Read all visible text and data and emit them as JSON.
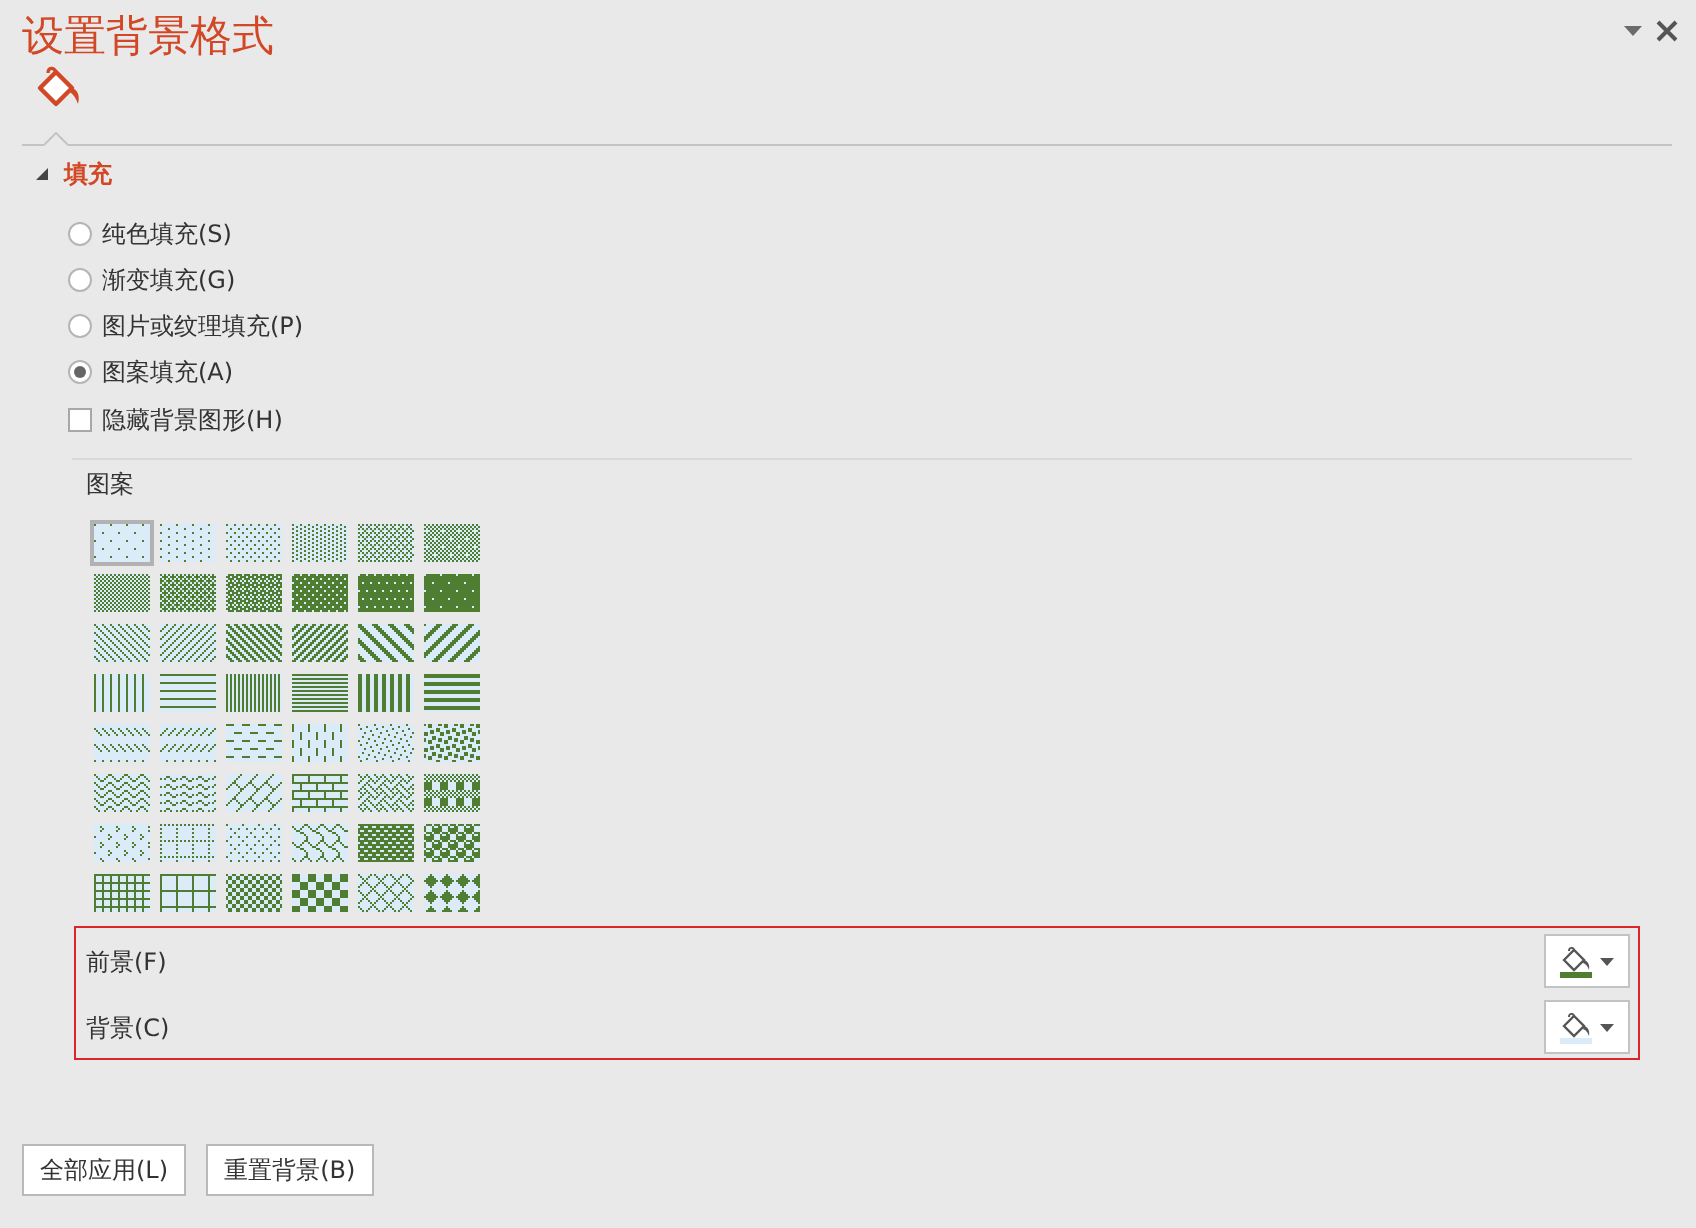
{
  "panel": {
    "title": "设置背景格式"
  },
  "section": {
    "label": "填充",
    "expanded": true
  },
  "fill_options": [
    {
      "label": "纯色填充(S)",
      "selected": false
    },
    {
      "label": "渐变填充(G)",
      "selected": false
    },
    {
      "label": "图片或纹理填充(P)",
      "selected": false
    },
    {
      "label": "图案填充(A)",
      "selected": true
    }
  ],
  "hide_graphics": {
    "label": "隐藏背景图形(H)",
    "checked": false
  },
  "pattern_group": {
    "label": "图案",
    "patterns": [
      {
        "kind": "pct5",
        "selected": true
      },
      {
        "kind": "pct10",
        "selected": false
      },
      {
        "kind": "pct20",
        "selected": false
      },
      {
        "kind": "pct25",
        "selected": false
      },
      {
        "kind": "pct30",
        "selected": false
      },
      {
        "kind": "pct40",
        "selected": false
      },
      {
        "kind": "pct50",
        "selected": false
      },
      {
        "kind": "pct60",
        "selected": false
      },
      {
        "kind": "pct70",
        "selected": false
      },
      {
        "kind": "pct75",
        "selected": false
      },
      {
        "kind": "pct80",
        "selected": false
      },
      {
        "kind": "pct90",
        "selected": false
      },
      {
        "kind": "lightdowndiag",
        "selected": false
      },
      {
        "kind": "lightupdiag",
        "selected": false
      },
      {
        "kind": "darkdowndiag",
        "selected": false
      },
      {
        "kind": "darkupdiag",
        "selected": false
      },
      {
        "kind": "widedowndiag",
        "selected": false
      },
      {
        "kind": "wideupdiag",
        "selected": false
      },
      {
        "kind": "lightvertical",
        "selected": false
      },
      {
        "kind": "lighthorizontal",
        "selected": false
      },
      {
        "kind": "narrowvertical",
        "selected": false
      },
      {
        "kind": "narrowhorizontal",
        "selected": false
      },
      {
        "kind": "darkvertical",
        "selected": false
      },
      {
        "kind": "darkhorizontal",
        "selected": false
      },
      {
        "kind": "dasheddowndiag",
        "selected": false
      },
      {
        "kind": "dashedupdiag",
        "selected": false
      },
      {
        "kind": "dashedhorizontal",
        "selected": false
      },
      {
        "kind": "dashedvertical",
        "selected": false
      },
      {
        "kind": "smallconfetti",
        "selected": false
      },
      {
        "kind": "largeconfetti",
        "selected": false
      },
      {
        "kind": "zigzag",
        "selected": false
      },
      {
        "kind": "wave",
        "selected": false
      },
      {
        "kind": "diagonalbrick",
        "selected": false
      },
      {
        "kind": "horizontalbrick",
        "selected": false
      },
      {
        "kind": "weave",
        "selected": false
      },
      {
        "kind": "plaid",
        "selected": false
      },
      {
        "kind": "divot",
        "selected": false
      },
      {
        "kind": "dottedgrid",
        "selected": false
      },
      {
        "kind": "dotteddiamond",
        "selected": false
      },
      {
        "kind": "shingle",
        "selected": false
      },
      {
        "kind": "trellis",
        "selected": false
      },
      {
        "kind": "sphere",
        "selected": false
      },
      {
        "kind": "smallgrid",
        "selected": false
      },
      {
        "kind": "largegrid",
        "selected": false
      },
      {
        "kind": "smallchecker",
        "selected": false
      },
      {
        "kind": "largechecker",
        "selected": false
      },
      {
        "kind": "outlineddiamond",
        "selected": false
      },
      {
        "kind": "soliddiamond",
        "selected": false
      }
    ]
  },
  "color_section": {
    "highlighted": true,
    "pickers": [
      {
        "label": "前景(F)",
        "color": "#4f7d32"
      },
      {
        "label": "背景(C)",
        "color": "#dcebf8"
      }
    ]
  },
  "buttons": [
    {
      "label": "全部应用(L)"
    },
    {
      "label": "重置背景(B)"
    }
  ]
}
